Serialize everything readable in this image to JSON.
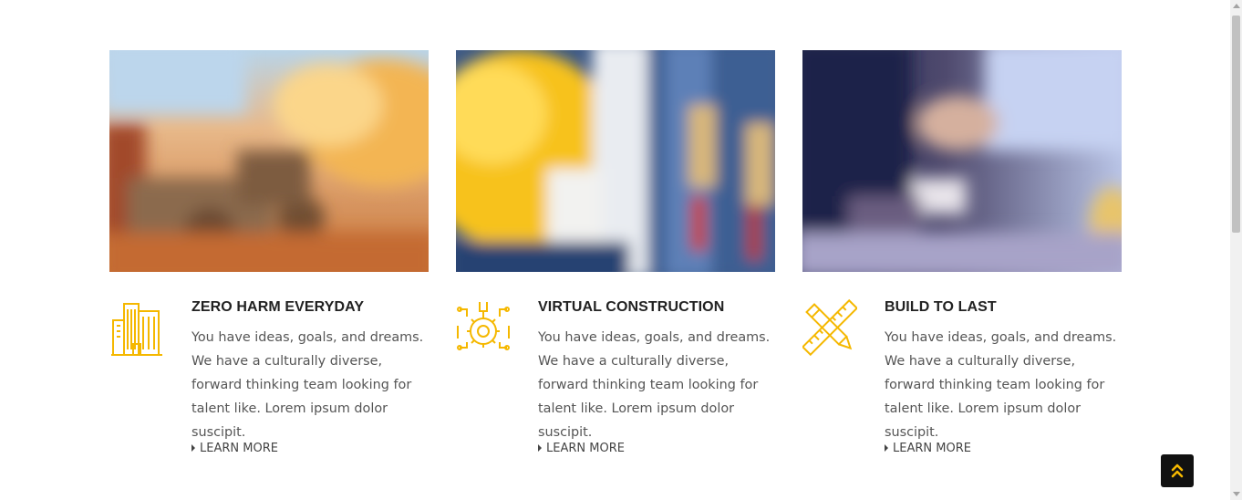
{
  "accent_color": "#f5b800",
  "cards": [
    {
      "image": "construction-site-bulldozer-photo",
      "icon": "buildings-icon",
      "title": "ZERO HARM EVERYDAY",
      "description": "You have ideas, goals, and dreams. We have a culturally diverse, forward thinking team looking for talent like. Lorem ipsum dolor suscipit.",
      "link": "LEARN MORE"
    },
    {
      "image": "hard-hat-and-tools-photo",
      "icon": "gear-wrench-icon",
      "title": "VIRTUAL CONSTRUCTION",
      "description": "You have ideas, goals, and dreams. We have a culturally diverse, forward thinking team looking for talent like. Lorem ipsum dolor suscipit.",
      "link": "LEARN MORE"
    },
    {
      "image": "handshake-photo",
      "icon": "pencil-ruler-icon",
      "title": "BUILD TO LAST",
      "description": "You have ideas, goals, and dreams. We have a culturally diverse, forward thinking team looking for talent like. Lorem ipsum dolor suscipit.",
      "link": "LEARN MORE"
    }
  ],
  "back_to_top": {
    "icon": "double-chevron-up-icon"
  }
}
